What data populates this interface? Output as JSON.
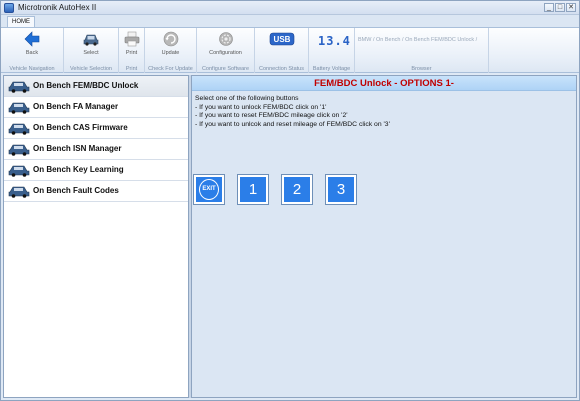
{
  "window": {
    "title": "Microtronik AutoHex II"
  },
  "controls": {
    "minimize": "_",
    "maximize": "□",
    "close": "✕"
  },
  "ribbon": {
    "tab": "HOME",
    "groups": [
      {
        "label": "Vehicle Navigation",
        "button": "Back",
        "icon": "back-arrow-icon"
      },
      {
        "label": "Vehicle Selection",
        "button": "Select",
        "icon": "car-icon"
      },
      {
        "label": "Print",
        "button": "Print",
        "icon": "printer-icon"
      },
      {
        "label": "Check For Update",
        "button": "Update",
        "icon": "update-icon"
      },
      {
        "label": "Configure Software",
        "button": "Configuration",
        "icon": "gear-icon"
      },
      {
        "label": "Connection Status",
        "button": "USB",
        "icon": "usb-icon"
      },
      {
        "label": "Battery Voltage",
        "button": "13.4",
        "icon": "voltage-display"
      },
      {
        "label": "Browser",
        "button": "BMW / On Bench / On Bench FEM/BDC Unlock /",
        "icon": ""
      }
    ]
  },
  "nav": {
    "items": [
      {
        "label": "On Bench FEM/BDC Unlock",
        "active": true
      },
      {
        "label": "On Bench FA Manager",
        "active": false
      },
      {
        "label": "On Bench CAS Firmware",
        "active": false
      },
      {
        "label": "On Bench ISN Manager",
        "active": false
      },
      {
        "label": "On Bench Key Learning",
        "active": false
      },
      {
        "label": "On Bench Fault Codes",
        "active": false
      }
    ]
  },
  "content": {
    "title": "FEM/BDC Unlock - OPTIONS 1-",
    "lines": [
      "Select one of the following buttons",
      "- If you want to unlock FEM/BDC click on '1'",
      "- If you want to reset FEM/BDC mileage click on '2'",
      "- If you want to unlcok and reset mileage of FEM/BDC click on '3'"
    ],
    "buttons": {
      "exit": "EXIT",
      "one": "1",
      "two": "2",
      "three": "3"
    }
  },
  "colors": {
    "accent": "#2b7ee8",
    "title_red": "#c00000",
    "back_arrow": "#1f6fd6"
  }
}
